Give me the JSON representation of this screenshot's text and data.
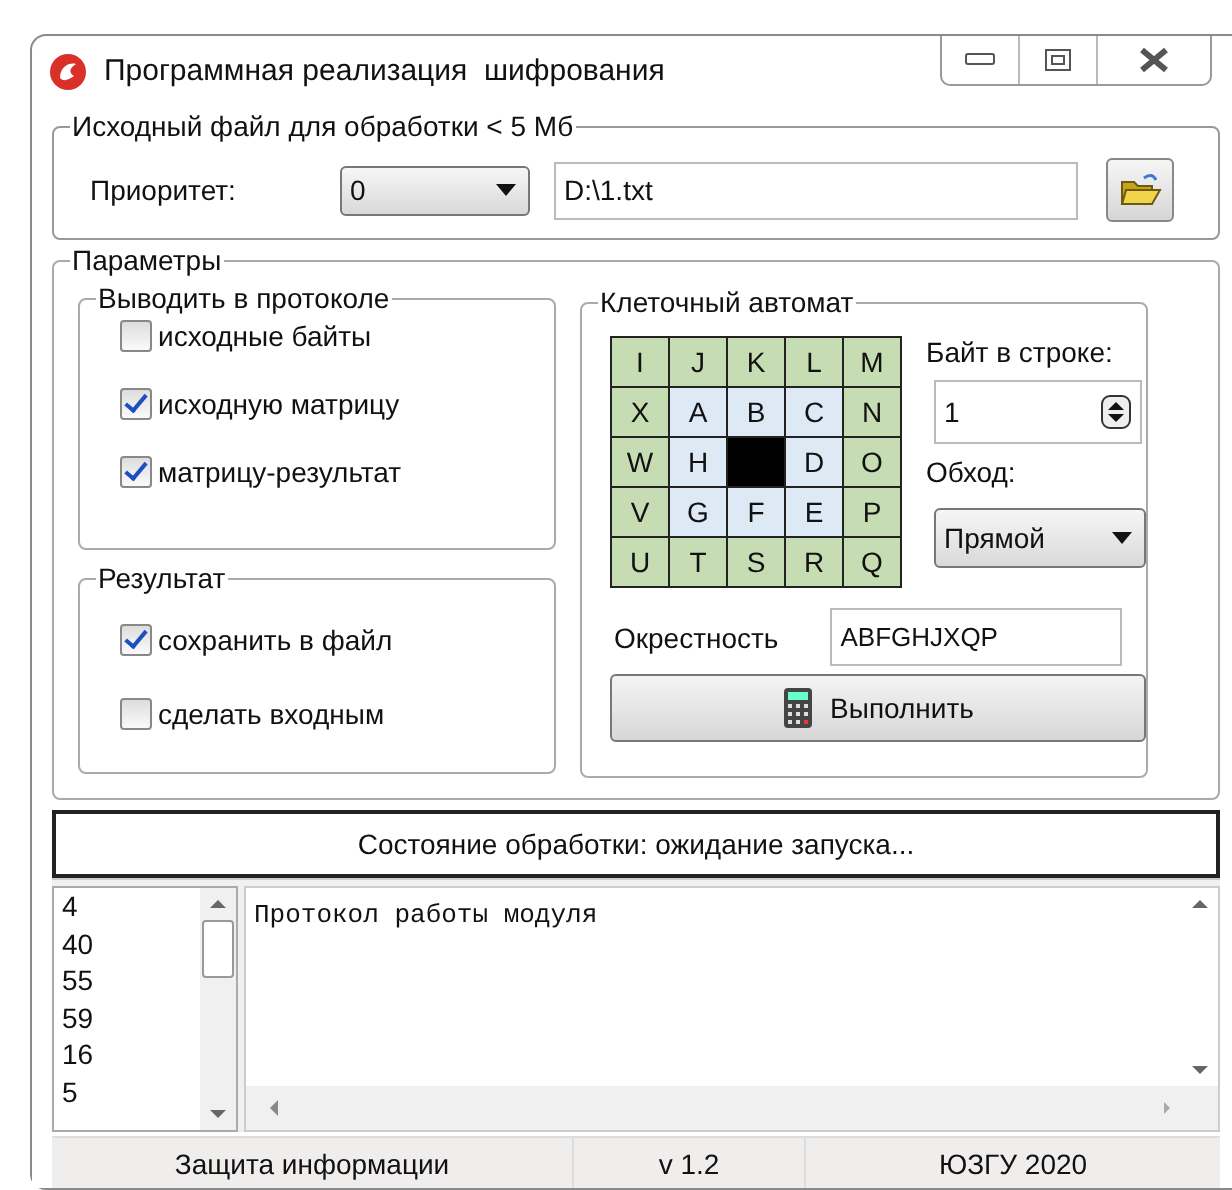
{
  "window": {
    "title": "Программная реализация  шифрования"
  },
  "source": {
    "legend": "Исходный файл для обработки < 5 Мб",
    "priority_label": "Приоритет:",
    "priority_value": "0",
    "file_path": "D:\\1.txt"
  },
  "params": {
    "legend": "Параметры",
    "log_group": {
      "legend": "Выводить в протоколе",
      "options": [
        {
          "label": "исходные байты",
          "checked": false
        },
        {
          "label": "исходную матрицу",
          "checked": true
        },
        {
          "label": "матрицу-результат",
          "checked": true
        }
      ]
    },
    "result_group": {
      "legend": "Результат",
      "options": [
        {
          "label": "сохранить в файл",
          "checked": true
        },
        {
          "label": "сделать входным",
          "checked": false
        }
      ]
    },
    "automaton": {
      "legend": "Клеточный автомат",
      "grid": [
        [
          {
            "text": "I",
            "kind": "outer"
          },
          {
            "text": "J",
            "kind": "outer"
          },
          {
            "text": "K",
            "kind": "outer"
          },
          {
            "text": "L",
            "kind": "outer"
          },
          {
            "text": "M",
            "kind": "outer"
          }
        ],
        [
          {
            "text": "X",
            "kind": "outer"
          },
          {
            "text": "A",
            "kind": "inner"
          },
          {
            "text": "B",
            "kind": "inner"
          },
          {
            "text": "C",
            "kind": "inner"
          },
          {
            "text": "N",
            "kind": "outer"
          }
        ],
        [
          {
            "text": "W",
            "kind": "outer"
          },
          {
            "text": "H",
            "kind": "inner"
          },
          {
            "kind": "center"
          },
          {
            "text": "D",
            "kind": "inner"
          },
          {
            "text": "O",
            "kind": "outer"
          }
        ],
        [
          {
            "text": "V",
            "kind": "outer"
          },
          {
            "text": "G",
            "kind": "inner"
          },
          {
            "text": "F",
            "kind": "inner"
          },
          {
            "text": "E",
            "kind": "inner"
          },
          {
            "text": "P",
            "kind": "outer"
          }
        ],
        [
          {
            "text": "U",
            "kind": "outer"
          },
          {
            "text": "T",
            "kind": "outer"
          },
          {
            "text": "S",
            "kind": "outer"
          },
          {
            "text": "R",
            "kind": "outer"
          },
          {
            "text": "Q",
            "kind": "outer"
          }
        ]
      ],
      "bytes_label": "Байт в строке:",
      "bytes_value": "1",
      "traversal_label": "Обход:",
      "traversal_value": "Прямой",
      "neighborhood_label": "Окрестность",
      "neighborhood_value": "ABFGHJXQP",
      "run_button": "Выполнить"
    }
  },
  "status": "Состояние обработки: ожидание запуска...",
  "numbers": [
    "4",
    "40",
    "55",
    "59",
    "16",
    "5"
  ],
  "log": "Протокол работы модуля",
  "status_bar": [
    "Защита информации",
    "v 1.2",
    "ЮЗГУ 2020"
  ]
}
